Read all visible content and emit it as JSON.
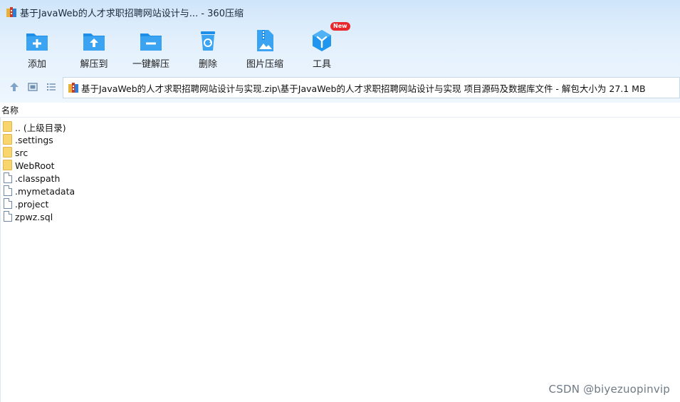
{
  "window": {
    "title": "基于JavaWeb的人才求职招聘网站设计与... - 360压缩"
  },
  "toolbar": {
    "items": [
      {
        "label": "添加",
        "icon": "add-folder-icon"
      },
      {
        "label": "解压到",
        "icon": "extract-folder-icon"
      },
      {
        "label": "一键解压",
        "icon": "quick-extract-icon"
      },
      {
        "label": "删除",
        "icon": "delete-bin-icon"
      },
      {
        "label": "图片压缩",
        "icon": "image-compress-icon"
      },
      {
        "label": "工具",
        "icon": "tools-cube-icon",
        "badge": "New"
      }
    ]
  },
  "nav": {
    "path": "基于JavaWeb的人才求职招聘网站设计与实现.zip\\基于JavaWeb的人才求职招聘网站设计与实现 项目源码及数据库文件 - 解包大小为 27.1 MB"
  },
  "list": {
    "column_name": "名称",
    "items": [
      {
        "name": ".. (上级目录)",
        "type": "folder"
      },
      {
        "name": ".settings",
        "type": "folder"
      },
      {
        "name": "src",
        "type": "folder"
      },
      {
        "name": "WebRoot",
        "type": "folder"
      },
      {
        "name": ".classpath",
        "type": "file"
      },
      {
        "name": ".mymetadata",
        "type": "file"
      },
      {
        "name": ".project",
        "type": "file"
      },
      {
        "name": "zpwz.sql",
        "type": "file"
      }
    ]
  },
  "watermark": "CSDN @biyezuopinvip",
  "colors": {
    "accent": "#1e8fe8",
    "badge": "#e8262b",
    "folder": "#f9d66d"
  }
}
